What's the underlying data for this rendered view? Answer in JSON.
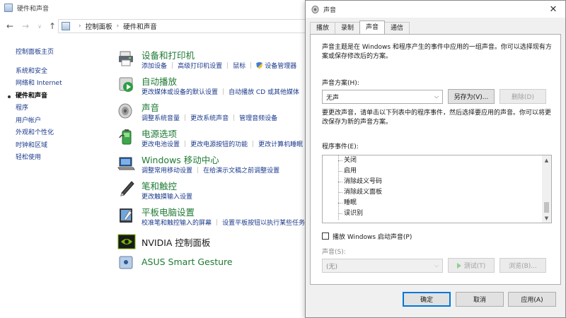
{
  "control_panel": {
    "window_title": "硬件和声音",
    "address": {
      "root": "控制面板",
      "current": "硬件和声音"
    },
    "sidebar": [
      {
        "label": "控制面板主页"
      },
      {
        "label": "系统和安全"
      },
      {
        "label": "网络和 Internet"
      },
      {
        "label": "硬件和声音",
        "current": true
      },
      {
        "label": "程序"
      },
      {
        "label": "用户帐户"
      },
      {
        "label": "外观和个性化"
      },
      {
        "label": "时钟和区域"
      },
      {
        "label": "轻松使用"
      }
    ],
    "categories": [
      {
        "title": "设备和打印机",
        "icon": "printer-icon",
        "links": [
          "添加设备",
          "高级打印机设置",
          "鼠标",
          "设备管理器"
        ]
      },
      {
        "title": "自动播放",
        "icon": "autoplay-icon",
        "links": [
          "更改媒体或设备的默认设置",
          "自动播放 CD 或其他媒体"
        ]
      },
      {
        "title": "声音",
        "icon": "speaker-icon",
        "links": [
          "调整系统音量",
          "更改系统声音",
          "管理音频设备"
        ]
      },
      {
        "title": "电源选项",
        "icon": "battery-icon",
        "links": [
          "更改电池设置",
          "更改电源按钮的功能",
          "更改计算机睡眠"
        ]
      },
      {
        "title": "Windows 移动中心",
        "icon": "mobility-center-icon",
        "links": [
          "调整常用移动设置",
          "在给演示文稿之前调整设置"
        ]
      },
      {
        "title": "笔和触控",
        "icon": "pen-icon",
        "links": [
          "更改触摸输入设置"
        ]
      },
      {
        "title": "平板电脑设置",
        "icon": "tablet-icon",
        "links": [
          "校准笔和触控输入的屏幕",
          "设置平板按钮以执行某些任务"
        ]
      },
      {
        "title": "NVIDIA 控制面板",
        "icon": "nvidia-icon",
        "links": []
      },
      {
        "title": "ASUS Smart Gesture",
        "icon": "touchpad-icon",
        "links": []
      }
    ]
  },
  "sound_dialog": {
    "title": "声音",
    "close_glyph": "✕",
    "tabs": [
      "播放",
      "录制",
      "声音",
      "通信"
    ],
    "active_tab": 2,
    "intro": "声音主题是在 Windows 和程序产生的事件中应用的一组声音。你可以选择现有方案或保存修改后的方案。",
    "scheme_label": "声音方案(H):",
    "scheme_value": "无声",
    "save_as": "另存为(V)...",
    "delete": "删除(D)",
    "instructions": "要更改声音，请单击以下列表中的程序事件，然后选择要应用的声音。你可以将更改保存为新的声音方案。",
    "events_label": "程序事件(E):",
    "events": [
      "关闭",
      "启用",
      "消除歧义号码",
      "消除歧义面板",
      "睡眠",
      "误识别"
    ],
    "startup_checkbox": "播放 Windows 启动声音(P)",
    "startup_checked": false,
    "sound_label": "声音(S):",
    "sound_value": "(无)",
    "test": "测试(T)",
    "browse": "浏览(B)...",
    "ok": "确定",
    "cancel": "取消",
    "apply": "应用(A)"
  },
  "colors": {
    "link": "#1b3a8c",
    "category_title": "#1e7a34",
    "focus_blue": "#0078d7"
  }
}
